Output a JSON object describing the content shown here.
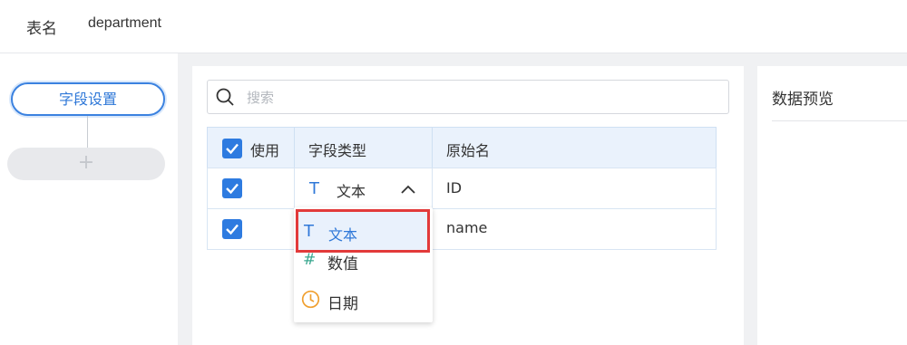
{
  "header": {
    "table_name_label": "表名",
    "table_name_value": "department"
  },
  "steps": {
    "active_label": "字段设置",
    "add_label": "+"
  },
  "search": {
    "placeholder": "搜索"
  },
  "table": {
    "headers": [
      "使用",
      "字段类型",
      "原始名"
    ],
    "rows": [
      {
        "checked": true,
        "type_icon": "T",
        "type_label": "文本",
        "original_name": "ID"
      },
      {
        "checked": true,
        "original_name": "name"
      }
    ]
  },
  "type_dropdown": {
    "options": [
      {
        "icon": "T",
        "label": "文本",
        "icon_name": "text-type-icon",
        "selected": true
      },
      {
        "icon": "#",
        "label": "数值",
        "icon_name": "number-type-icon"
      },
      {
        "icon": "clock",
        "label": "日期",
        "icon_name": "date-type-icon"
      }
    ]
  },
  "preview": {
    "title": "数据预览"
  },
  "colors": {
    "accent": "#2e7be0",
    "highlight": "#e23a3a",
    "number_icon": "#3aa78f",
    "date_icon": "#f0a030"
  }
}
